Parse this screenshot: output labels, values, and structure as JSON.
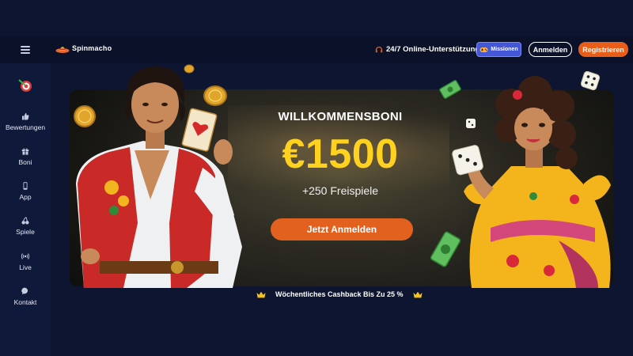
{
  "header": {
    "logo_text": "Spinmacho",
    "support_text": "24/7 Online-Unterstützung",
    "missions_label": "Missionen",
    "login_label": "Anmelden",
    "register_label": "Registrieren"
  },
  "sidebar": {
    "items": [
      {
        "label": "Bewertungen",
        "icon": "thumbs-up-icon"
      },
      {
        "label": "Boni",
        "icon": "gift-icon"
      },
      {
        "label": "App",
        "icon": "phone-icon"
      },
      {
        "label": "Spiele",
        "icon": "cherries-icon"
      },
      {
        "label": "Live",
        "icon": "broadcast-icon"
      },
      {
        "label": "Kontakt",
        "icon": "chat-icon"
      }
    ]
  },
  "banner": {
    "title": "WILLKOMMENSBONI",
    "amount": "€1500",
    "spins": "+250 Freispiele",
    "cta_label": "Jetzt Anmelden"
  },
  "cashback": {
    "text": "Wöchentliches Cashback Bis Zu 25 %"
  },
  "colors": {
    "background": "#0d1530",
    "sidebar": "#0f1a3b",
    "accent_orange": "#e2611e",
    "missions_blue": "#4457d6",
    "bonus_yellow": "#ffd21f"
  }
}
